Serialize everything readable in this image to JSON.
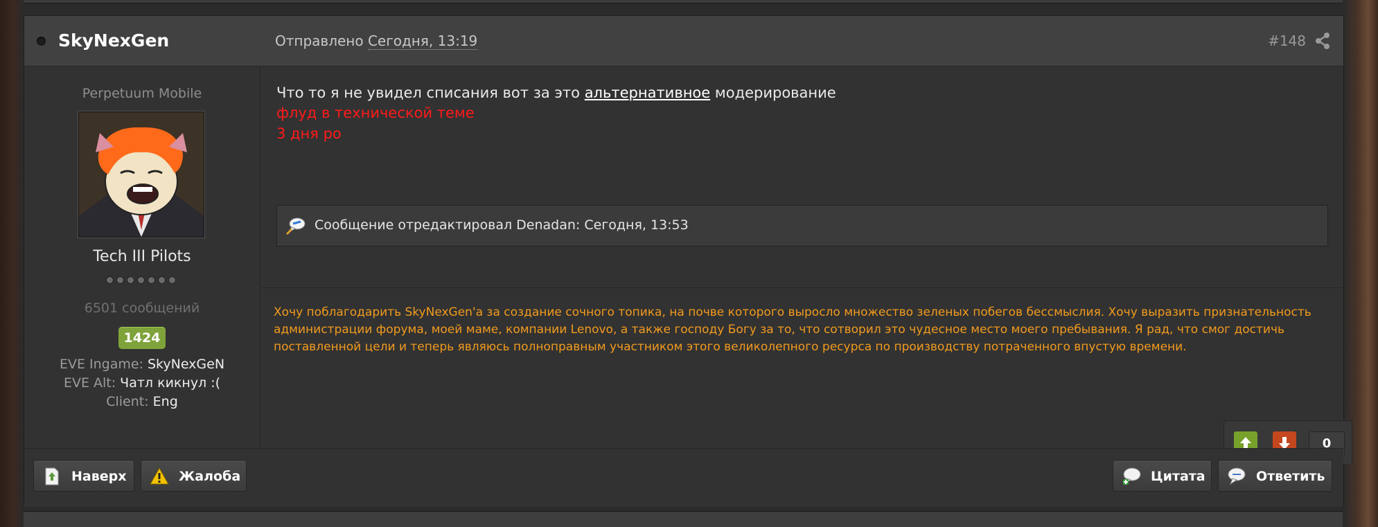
{
  "post": {
    "author": "SkyNexGen",
    "posted_prefix": "Отправлено",
    "posted_date": "Сегодня, 13:19",
    "post_number": "#148"
  },
  "author_info": {
    "member_title": "Perpetuum Mobile",
    "group": "Tech III Pilots",
    "pips_count": 7,
    "posts_count": "6501 сообщений",
    "reputation": "1424",
    "fields": [
      {
        "label": "EVE Ingame:",
        "value": "SkyNexGeN"
      },
      {
        "label": "EVE Alt:",
        "value": "Чатл кикнул :("
      },
      {
        "label": "Client:",
        "value": "Eng"
      }
    ]
  },
  "content": {
    "text_before": "Что то я не увидел списания вот за это ",
    "link_text": "альтернативное",
    "text_after": " модерирование",
    "red_line_1": "флуд в технической теме",
    "red_line_2": "3 дня ро",
    "edit_note": "Сообщение отредактировал Denadan: Сегодня, 13:53",
    "signature": "Хочу поблагодарить SkyNexGen'a за создание сочного топика, на почве которого выросло множество зеленых побегов бессмыслия. Хочу выразить признательность администрации форума, моей маме, компании Lenovo, а также господу Богу за то, что сотворил это чудесное место моего пребывания. Я рад, что смог достичь поставленной цели и теперь являюсь полноправным участником этого великолепного ресурса по производству потраченного впустую времени."
  },
  "rating": {
    "count": "0"
  },
  "buttons": {
    "top": "Наверх",
    "report": "Жалоба",
    "quote": "Цитата",
    "reply": "Ответить"
  },
  "colors": {
    "moderation_red": "#ff1a1a",
    "signature_orange": "#f29b1e",
    "reputation_green": "#7ea33a",
    "rate_up_green": "#78a12c",
    "rate_down_red": "#c4471e"
  }
}
